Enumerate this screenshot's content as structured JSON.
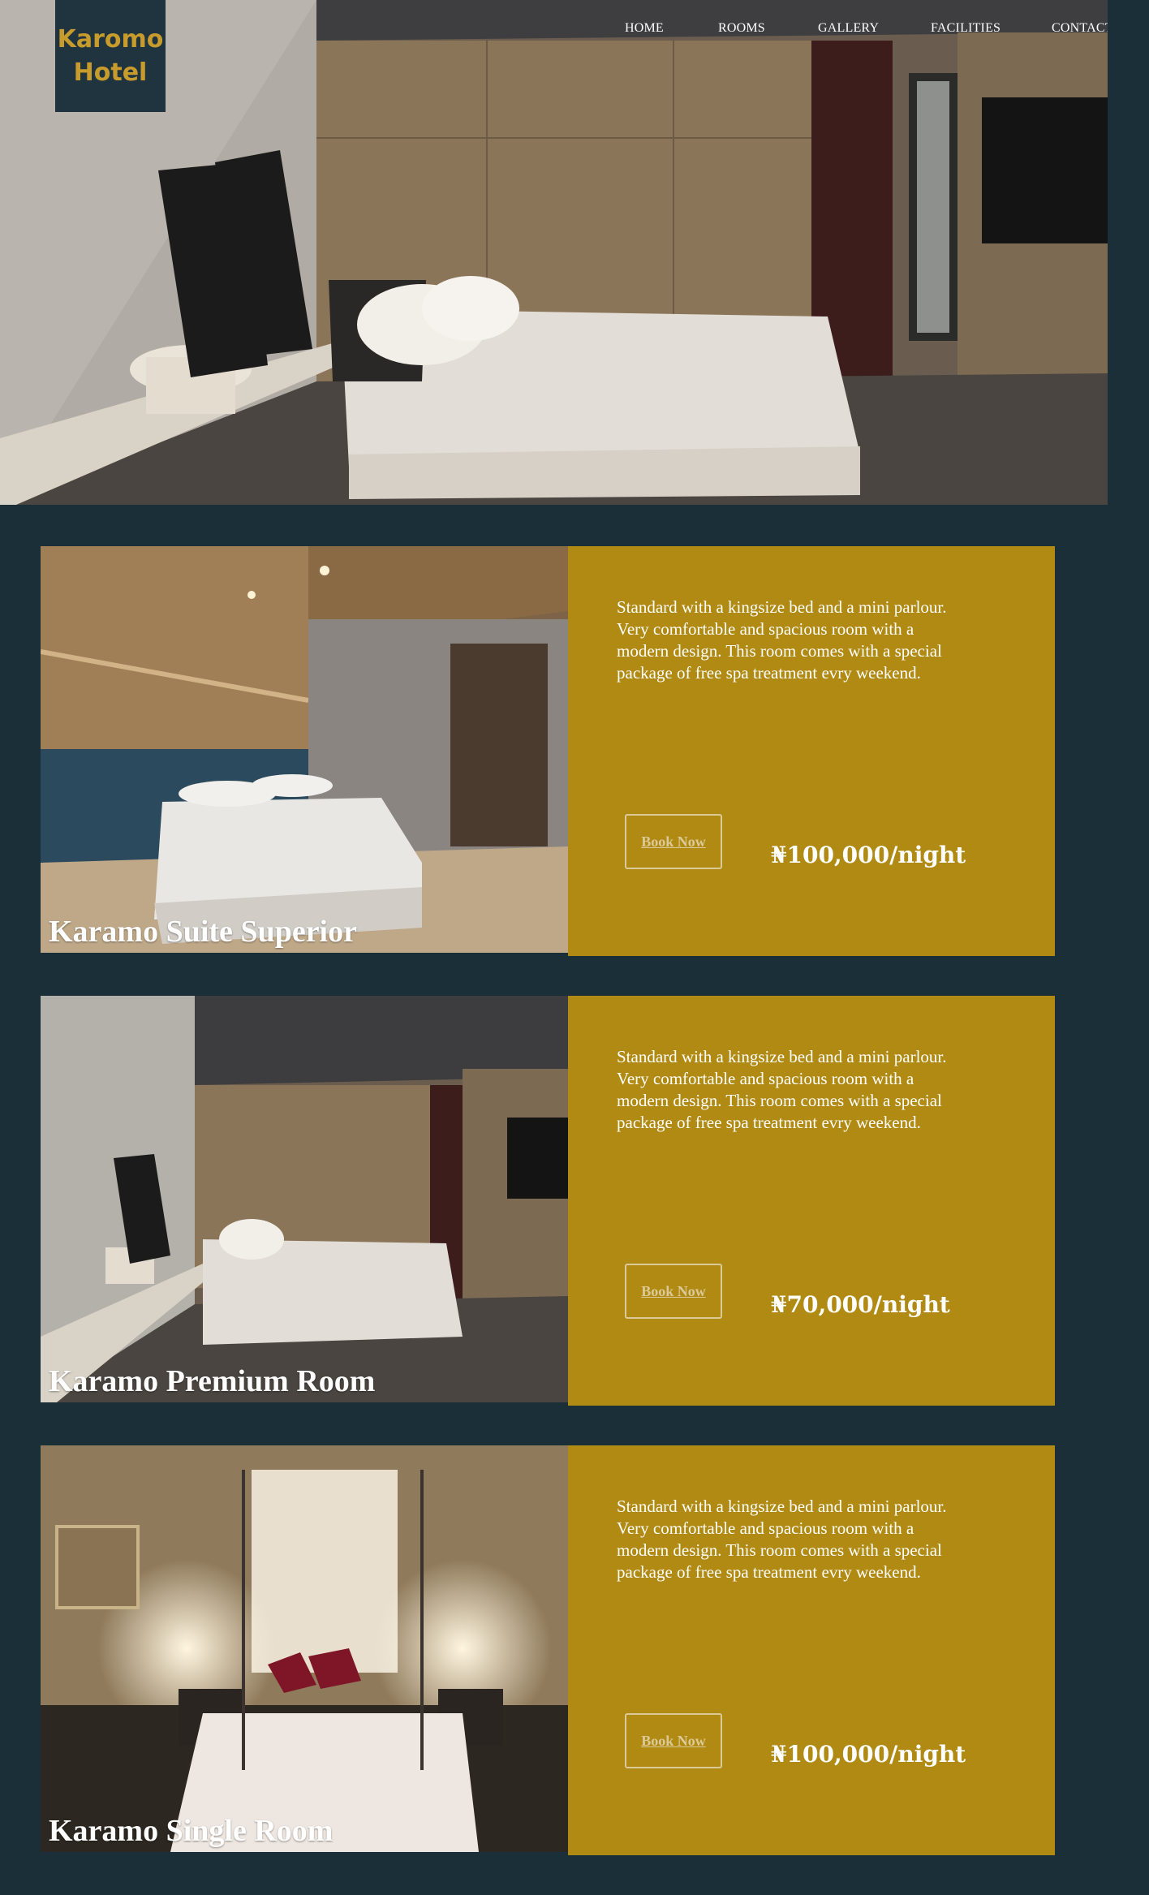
{
  "brand": {
    "line1": "Karomo",
    "line2": "Hotel"
  },
  "nav": {
    "home": "HOME",
    "rooms": "ROOMS",
    "gallery": "GALLERY",
    "facilities": "FACILITIES",
    "contact": "CONTACT"
  },
  "rooms": [
    {
      "name": "Karamo Suite Superior",
      "description": "Standard with a kingsize bed and a mini parlour. Very comfortable and spacious room with a modern design. This room comes with a special package of free spa treatment evry weekend.",
      "book_label": "Book Now",
      "price": "₦100,000/night"
    },
    {
      "name": "Karamo Premium Room",
      "description": "Standard with a kingsize bed and a mini parlour. Very comfortable and spacious room with a modern design. This room comes with a special package of free spa treatment evry weekend.",
      "book_label": "Book Now",
      "price": "₦70,000/night"
    },
    {
      "name": "Karamo Single Room",
      "description": "Standard with a kingsize bed and a mini parlour. Very comfortable and spacious room with a modern design. This room comes with a special package of free spa treatment evry weekend.",
      "book_label": "Book Now",
      "price": "₦100,000/night"
    }
  ],
  "colors": {
    "background": "#1b2f38",
    "panel": "#b08a12",
    "logo_bg": "#1f343e",
    "logo_text": "#c79b2c"
  }
}
